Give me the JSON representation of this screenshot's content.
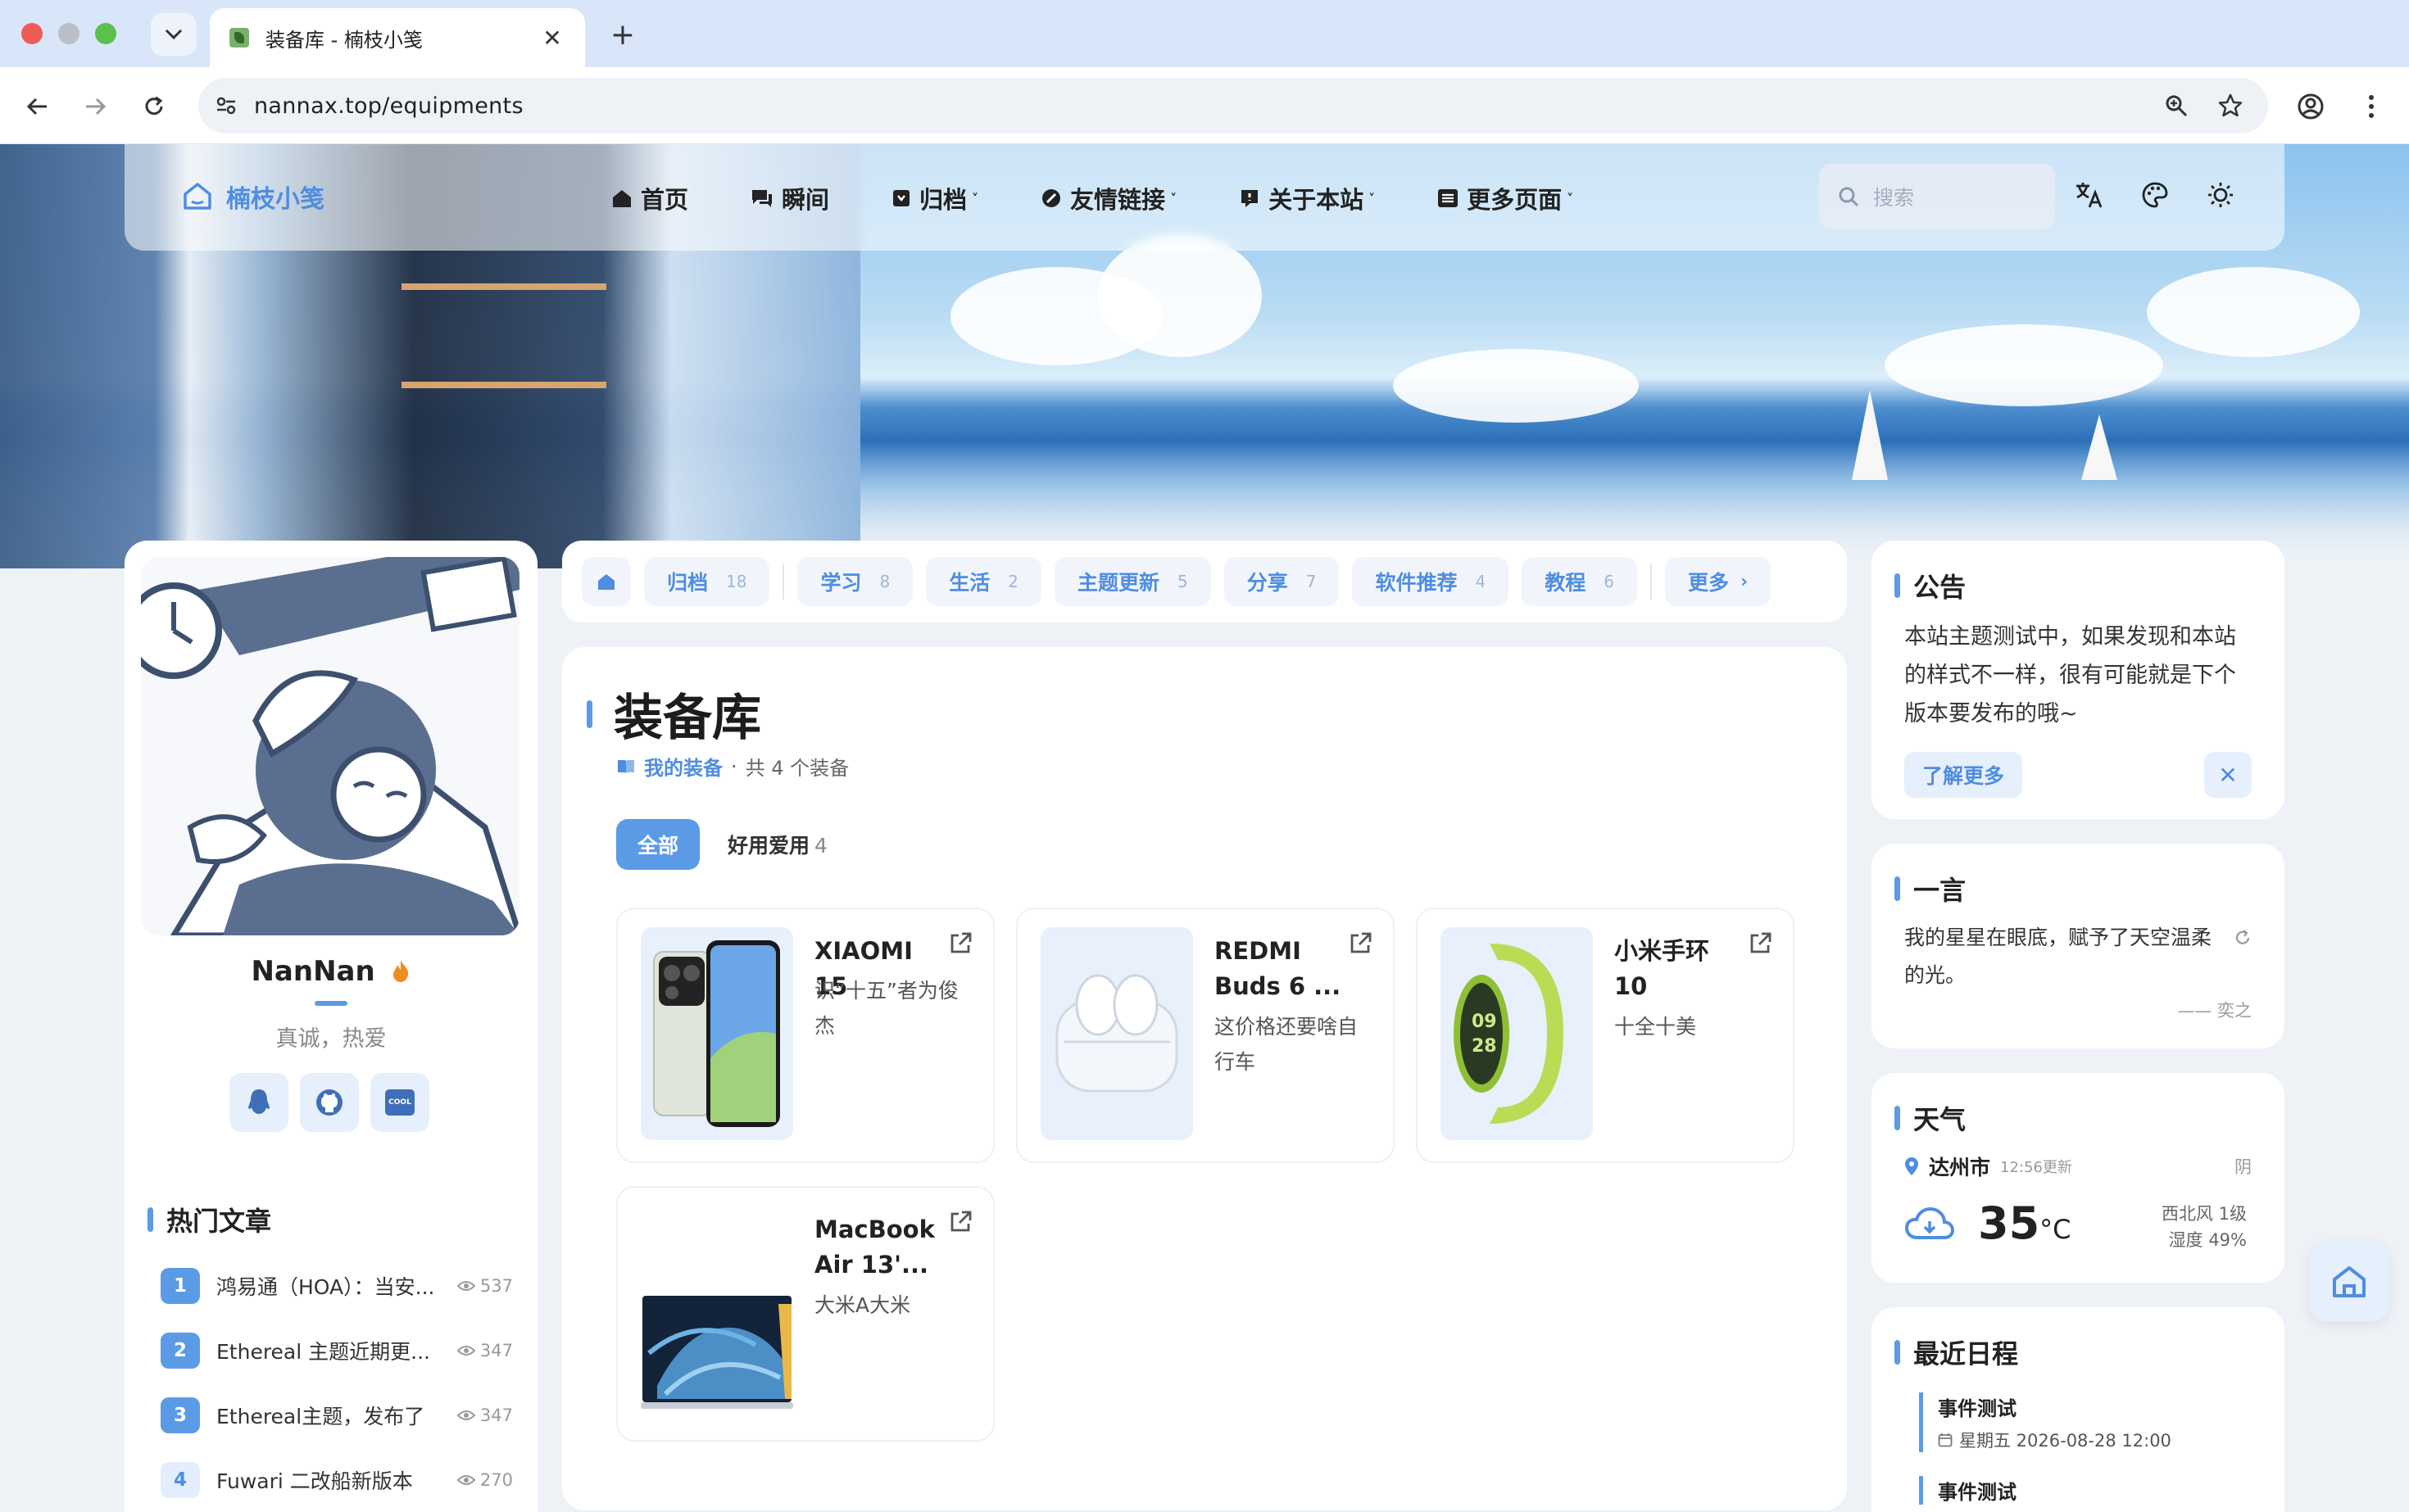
{
  "browser": {
    "tab_title": "装备库 - 楠枝小笺",
    "url": "nannax.top/equipments"
  },
  "nav": {
    "brand": "楠枝小笺",
    "items": [
      {
        "label": "首页",
        "icon": "home-icon"
      },
      {
        "label": "瞬间",
        "icon": "chat-icon"
      },
      {
        "label": "归档",
        "icon": "archive-icon",
        "caret": "˅"
      },
      {
        "label": "友情链接",
        "icon": "link-icon",
        "caret": "˅"
      },
      {
        "label": "关于本站",
        "icon": "info-icon",
        "caret": "˅"
      },
      {
        "label": "更多页面",
        "icon": "list-icon",
        "caret": "˅"
      }
    ],
    "search_placeholder": "搜索"
  },
  "profile": {
    "name": "NanNan",
    "bio": "真诚，热爱",
    "socials": [
      "qq-icon",
      "github-icon",
      "coolapk-icon"
    ],
    "cool_label": "COOL"
  },
  "hot": {
    "title": "热门文章",
    "items": [
      {
        "rank": "1",
        "title": "鸿易通（HOA）：当安...",
        "views": "537"
      },
      {
        "rank": "2",
        "title": "Ethereal 主题近期更...",
        "views": "347"
      },
      {
        "rank": "3",
        "title": "Ethereal主题，发布了",
        "views": "347"
      },
      {
        "rank": "4",
        "title": "Fuwari 二改船新版本",
        "views": "270"
      }
    ]
  },
  "categories": {
    "items": [
      {
        "label": "归档",
        "count": "18"
      },
      {
        "label": "学习",
        "count": "8"
      },
      {
        "label": "生活",
        "count": "2"
      },
      {
        "label": "主题更新",
        "count": "5"
      },
      {
        "label": "分享",
        "count": "7"
      },
      {
        "label": "软件推荐",
        "count": "4"
      },
      {
        "label": "教程",
        "count": "6"
      }
    ],
    "more": "更多"
  },
  "main": {
    "title": "装备库",
    "sub_link": "我的装备",
    "sub_sep": "·",
    "sub_count": "共 4 个装备",
    "filter_all": "全部",
    "filter_fav": "好用爱用",
    "filter_fav_count": "4",
    "equipments": [
      {
        "name": "XIAOMI 15",
        "desc": "识“十五”者为俊杰"
      },
      {
        "name": "REDMI Buds 6 ...",
        "desc": "这价格还要啥自行车"
      },
      {
        "name": "小米手环 10",
        "desc": "十全十美"
      },
      {
        "name": "MacBook Air 13'...",
        "desc": "大米A大米"
      }
    ]
  },
  "notice": {
    "title": "公告",
    "text": "本站主题测试中，如果发现和本站的样式不一样，很有可能就是下个版本要发布的哦~",
    "more": "了解更多",
    "close": "✕"
  },
  "quote": {
    "title": "一言",
    "text": "我的星星在眼底，赋予了天空温柔的光。",
    "author": "—— 奕之"
  },
  "weather": {
    "title": "天气",
    "city": "达州市",
    "updated": "12:56更新",
    "condition": "阴",
    "temp": "35",
    "unit": "°C",
    "wind": "西北风 1级",
    "humidity": "湿度 49%"
  },
  "schedule": {
    "title": "最近日程",
    "events": [
      {
        "title": "事件测试",
        "date": "星期五 2026-08-28 12:00"
      },
      {
        "title": "事件测试",
        "date": ""
      }
    ]
  },
  "colors": {
    "accent": "#5b9be6",
    "accent_light": "#e6effc"
  }
}
